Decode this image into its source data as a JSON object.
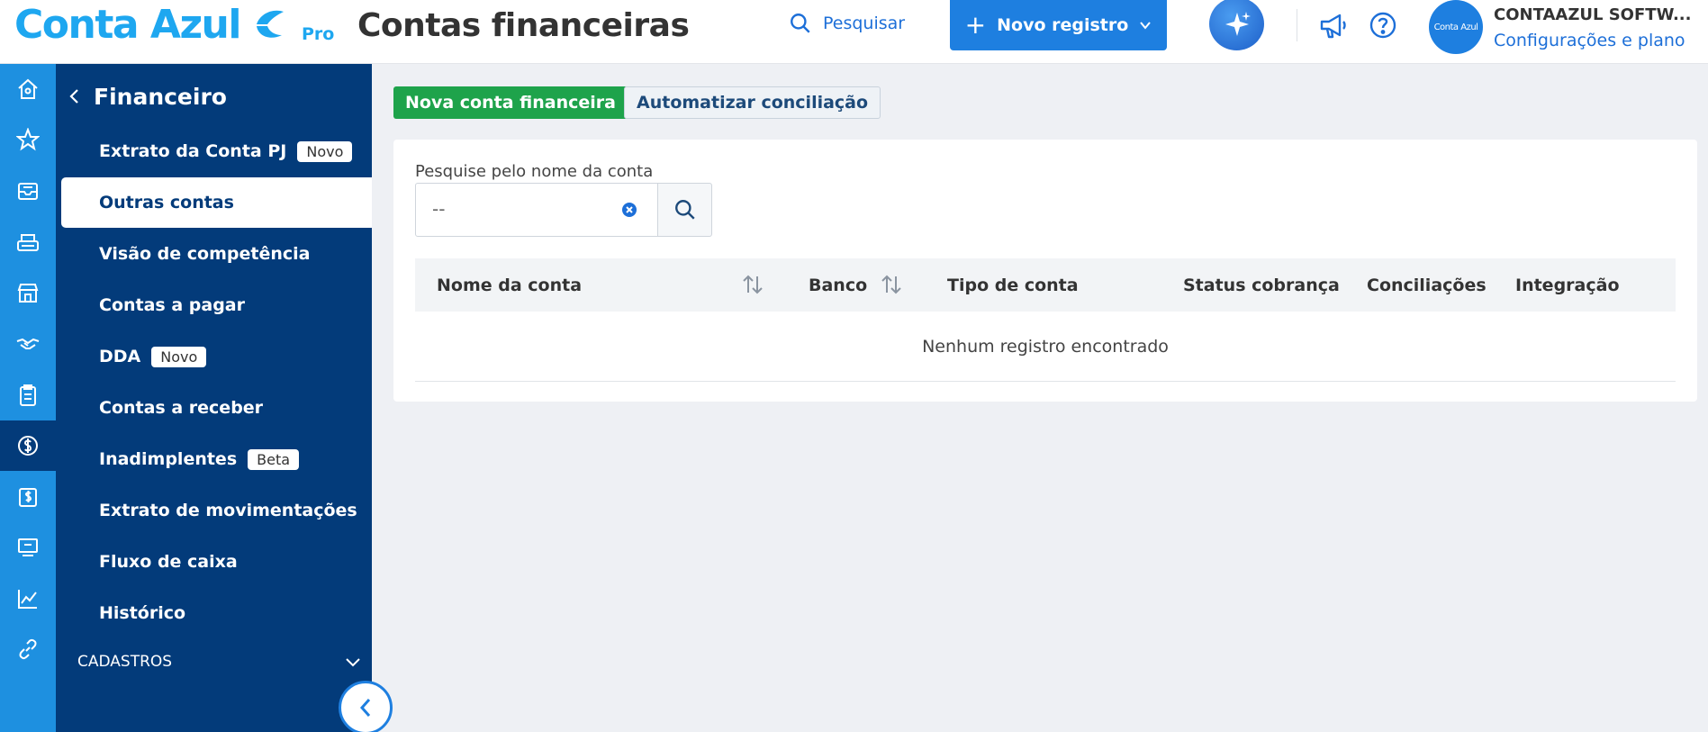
{
  "header": {
    "logo_text": "Conta Azul",
    "logo_tier": "Pro",
    "page_title": "Contas financeiras",
    "search_label": "Pesquisar",
    "new_record_label": "Novo registro",
    "avatar_text": "Conta Azul",
    "company_name": "CONTAAZUL SOFTW...",
    "settings_link": "Configurações e plano",
    "icons": [
      "search-icon",
      "plus-icon",
      "chevron-down-icon",
      "sparkle-icon",
      "megaphone-icon",
      "help-icon"
    ]
  },
  "rail": {
    "items": [
      "home-icon",
      "star-icon",
      "inbox-icon",
      "keyboard-icon",
      "store-icon",
      "handshake-icon",
      "clipboard-icon",
      "dollar-icon",
      "invoice-icon",
      "register-icon",
      "chart-icon",
      "link-icon"
    ],
    "active": "dollar-icon"
  },
  "sidebar": {
    "title": "Financeiro",
    "items": [
      {
        "label": "Extrato da Conta PJ",
        "badge": "Novo"
      },
      {
        "label": "Outras contas",
        "badge": ""
      },
      {
        "label": "Visão de competência",
        "badge": ""
      },
      {
        "label": "Contas a pagar",
        "badge": ""
      },
      {
        "label": "DDA",
        "badge": "Novo"
      },
      {
        "label": "Contas a receber",
        "badge": ""
      },
      {
        "label": "Inadimplentes",
        "badge": "Beta"
      },
      {
        "label": "Extrato de movimentações",
        "badge": ""
      },
      {
        "label": "Fluxo de caixa",
        "badge": ""
      },
      {
        "label": "Histórico",
        "badge": ""
      }
    ],
    "active_item": "Outras contas",
    "section_label": "CADASTROS"
  },
  "toolbar": {
    "new_account_label": "Nova conta financeira",
    "automate_label": "Automatizar conciliação"
  },
  "search": {
    "label": "Pesquise pelo nome da conta",
    "value": "--"
  },
  "table": {
    "columns": [
      "Nome da conta",
      "Banco",
      "Tipo de conta",
      "Status cobrança",
      "Conciliações",
      "Integração"
    ],
    "empty_message": "Nenhum registro encontrado"
  },
  "colors": {
    "brand_blue": "#1ea7f0",
    "primary_blue": "#1e7fe0",
    "sidebar_navy": "#033b7a",
    "success_green": "#1ea34b"
  }
}
